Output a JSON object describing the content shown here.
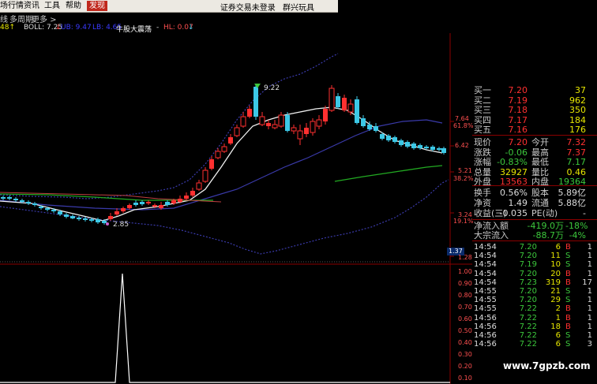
{
  "menu": {
    "items": [
      "场行情",
      "资讯",
      "工具",
      "帮助",
      "发现"
    ],
    "active": "发现",
    "right_items": [
      "证券交易未登录",
      "群兴玩具"
    ]
  },
  "subtabs": [
    "线",
    "多周期",
    "更多 >"
  ],
  "indicators": {
    "first": "48↑",
    "boll_label": "BOLL: 7.25",
    "boll_arrow": "↓",
    "ub": "UB: 9.47",
    "lb": "LB: 4.65",
    "bull_label": "牛股大震荡",
    "hl": "HL: 0.07",
    "hl_arrow": "↓"
  },
  "chart_annotations": {
    "high": "9.22",
    "low": "2.85"
  },
  "price_axis": {
    "labels": [
      "7.64",
      "6.42",
      "5.21",
      "3.24",
      "1.28"
    ],
    "percent_labels": [
      "61.8%",
      "38.2%",
      "19.1%"
    ],
    "current_marker": "1.37"
  },
  "indicator_axis": {
    "labels": [
      "1.00",
      "0.90",
      "0.80",
      "0.70",
      "0.60",
      "0.50",
      "0.40",
      "0.30",
      "0.20",
      "0.10"
    ]
  },
  "order_book": [
    {
      "label": "买一",
      "price": "7.20",
      "vol": "37"
    },
    {
      "label": "买二",
      "price": "7.19",
      "vol": "962"
    },
    {
      "label": "买三",
      "price": "7.18",
      "vol": "350"
    },
    {
      "label": "买四",
      "price": "7.17",
      "vol": "184"
    },
    {
      "label": "买五",
      "price": "7.16",
      "vol": "176"
    }
  ],
  "quote": [
    {
      "l1": "现价",
      "v1": "7.20",
      "c1": "#ff3030",
      "l2": "今开",
      "v2": "7.32",
      "c2": "#ff3030"
    },
    {
      "l1": "涨跌",
      "v1": "-0.06",
      "c1": "#3cc83c",
      "l2": "最高",
      "v2": "7.37",
      "c2": "#ff3030"
    },
    {
      "l1": "涨幅",
      "v1": "-0.83%",
      "c1": "#3cc83c",
      "l2": "最低",
      "v2": "7.17",
      "c2": "#3cc83c"
    },
    {
      "l1": "总量",
      "v1": "32927",
      "c1": "#e6e600",
      "l2": "量比",
      "v2": "0.46",
      "c2": "#e6e600"
    },
    {
      "l1": "外盘",
      "v1": "13563",
      "c1": "#ff3030",
      "l2": "内盘",
      "v2": "19364",
      "c2": "#3cc83c"
    }
  ],
  "stats": [
    {
      "l1": "换手",
      "v1": "0.56%",
      "l2": "股本",
      "v2": "5.89亿"
    },
    {
      "l1": "净资",
      "v1": "1.49",
      "l2": "流通",
      "v2": "5.88亿"
    },
    {
      "l1": "收益(三)",
      "v1": "-0.035",
      "l2": "PE(动)",
      "v2": "-"
    }
  ],
  "flows": [
    {
      "label": "净流入额",
      "value": "-419.0万",
      "pct": "-18%"
    },
    {
      "label": "大宗流入",
      "value": "-88.7万",
      "pct": "-4%"
    }
  ],
  "trades": [
    {
      "time": "14:54",
      "price": "7.20",
      "vol": "6",
      "side": "B",
      "n": "1"
    },
    {
      "time": "14:54",
      "price": "7.20",
      "vol": "11",
      "side": "S",
      "n": "1"
    },
    {
      "time": "14:54",
      "price": "7.19",
      "vol": "10",
      "side": "S",
      "n": "1"
    },
    {
      "time": "14:54",
      "price": "7.20",
      "vol": "20",
      "side": "B",
      "n": "1"
    },
    {
      "time": "14:54",
      "price": "7.23",
      "vol": "319",
      "side": "B",
      "n": "17"
    },
    {
      "time": "14:55",
      "price": "7.20",
      "vol": "21",
      "side": "S",
      "n": "1"
    },
    {
      "time": "14:55",
      "price": "7.20",
      "vol": "29",
      "side": "S",
      "n": "1"
    },
    {
      "time": "14:55",
      "price": "7.22",
      "vol": "2",
      "side": "B",
      "n": "1"
    },
    {
      "time": "14:56",
      "price": "7.22",
      "vol": "1",
      "side": "B",
      "n": "1"
    },
    {
      "time": "14:56",
      "price": "7.22",
      "vol": "18",
      "side": "B",
      "n": "1"
    },
    {
      "time": "14:56",
      "price": "7.22",
      "vol": "6",
      "side": "S",
      "n": "1"
    },
    {
      "time": "14:56",
      "price": "7.22",
      "vol": "6",
      "side": "S",
      "n": "3"
    }
  ],
  "watermark": "www.7gpzb.com",
  "colors": {
    "up": "#ff3030",
    "down": "#3cc8e6",
    "flat": "#ddd",
    "ma_green": "#22aa22",
    "boll": "#3a3aaa"
  }
}
